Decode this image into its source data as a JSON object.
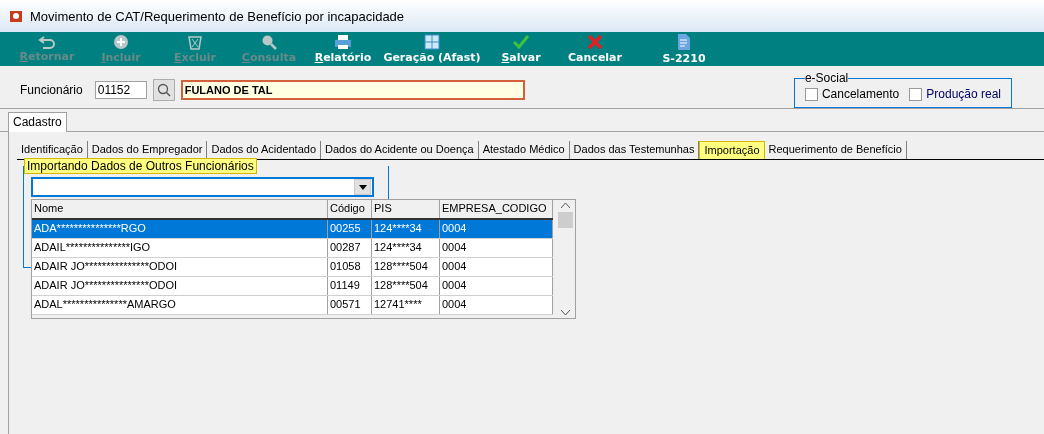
{
  "window": {
    "title": "Movimento de CAT/Requerimento de Benefício por incapacidade"
  },
  "toolbar": [
    {
      "label": "Retornar",
      "enabled": false,
      "underline_first": true
    },
    {
      "label": "Incluir",
      "enabled": false,
      "underline_first": true
    },
    {
      "label": "Excluir",
      "enabled": false,
      "underline_first": true
    },
    {
      "label": "Consulta",
      "enabled": false,
      "underline_first": true
    },
    {
      "label": "Relatório",
      "enabled": true,
      "underline_first": true
    },
    {
      "label": "Geração (Afast)",
      "enabled": true,
      "underline_first": false
    },
    {
      "label": "Salvar",
      "enabled": true,
      "underline_first": true
    },
    {
      "label": "Cancelar",
      "enabled": true,
      "underline_first": false
    },
    {
      "label": "S-2210",
      "enabled": true,
      "underline_first": false
    }
  ],
  "employee": {
    "label": "Funcionário",
    "code": "01152",
    "name": "FULANO DE TAL"
  },
  "esocial": {
    "title": "e-Social",
    "options": [
      {
        "label": "Cancelamento",
        "checked": false
      },
      {
        "label": "Produção real",
        "checked": false
      }
    ]
  },
  "outer_tabs": [
    {
      "label": "Cadastro",
      "selected": true
    }
  ],
  "tabs": [
    {
      "label": "Identificação",
      "selected": false
    },
    {
      "label": "Dados do Empregador",
      "selected": false
    },
    {
      "label": "Dados do Acidentado",
      "selected": false
    },
    {
      "label": "Dados do Acidente ou Doença",
      "selected": false
    },
    {
      "label": "Atestado Médico",
      "selected": false
    },
    {
      "label": "Dados das Testemunhas",
      "selected": false
    },
    {
      "label": "Importação",
      "selected": true
    },
    {
      "label": "Requerimento de Benefício",
      "selected": false
    }
  ],
  "import_group": {
    "title": "Importando Dados de Outros Funcionários",
    "grid": {
      "columns": [
        "Nome",
        "Código",
        "PIS",
        "EMPRESA_CODIGO"
      ],
      "rows": [
        {
          "cells": [
            "ADA***************RGO",
            "00255",
            "124****34",
            "0004"
          ],
          "selected": true
        },
        {
          "cells": [
            "ADAIL***************IGO",
            "00287",
            "124****34",
            "0004"
          ],
          "selected": false
        },
        {
          "cells": [
            "ADAIR JO***************ODOI",
            "01058",
            "128****504",
            "0004"
          ],
          "selected": false
        },
        {
          "cells": [
            "ADAIR JO***************ODOI",
            "01149",
            "128****504",
            "0004"
          ],
          "selected": false
        },
        {
          "cells": [
            "ADAL***************AMARGO",
            "00571",
            "12741****",
            "0004"
          ],
          "selected": false
        }
      ]
    }
  }
}
